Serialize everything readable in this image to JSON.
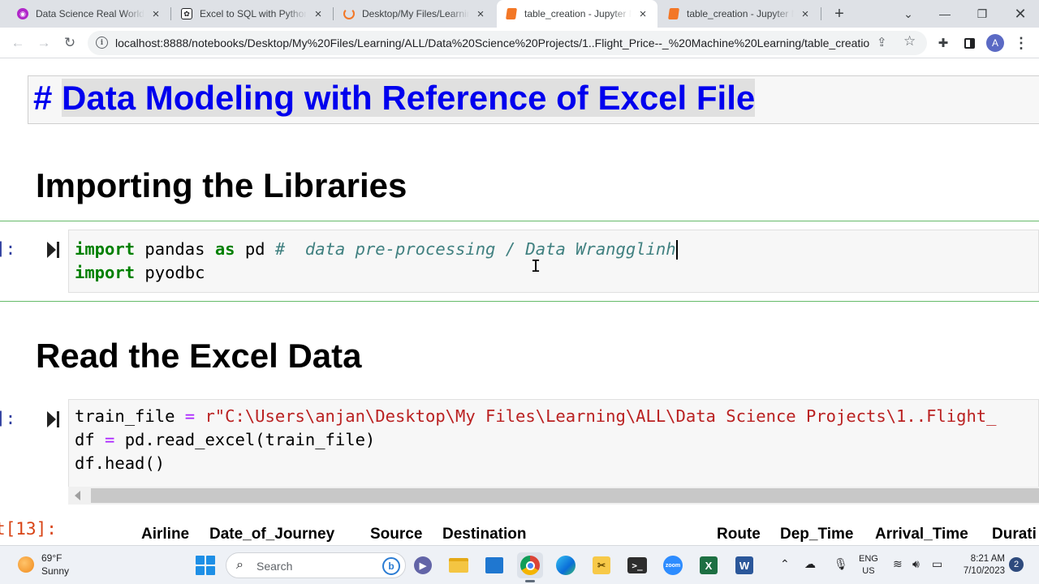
{
  "browser": {
    "tabs": [
      {
        "label": "Data Science Real World P",
        "icon": "youtube-icon",
        "color": "#c4302b"
      },
      {
        "label": "Excel to SQL with Python",
        "icon": "chatgpt-icon",
        "color": "#19a37e"
      },
      {
        "label": "Desktop/My Files/Learning",
        "icon": "jupyter-icon",
        "color": "#f37726"
      },
      {
        "label": "table_creation - Jupyter N",
        "icon": "notebook-icon",
        "color": "#f37726"
      },
      {
        "label": "table_creation - Jupyter N",
        "icon": "notebook-icon",
        "color": "#f37726"
      }
    ],
    "active_tab": 3,
    "new_tab_label": "+",
    "url": "localhost:8888/notebooks/Desktop/My%20Files/Learning/ALL/Data%20Science%20Projects/1..Flight_Price--_%20Machine%20Learning/table_creatio...",
    "profile_initial": "A"
  },
  "notebook": {
    "title_hash": "#",
    "title_text": "Data Modeling with Reference of Excel File",
    "heading_libraries": "Importing the Libraries",
    "heading_read": "Read the Excel Data",
    "cell1": {
      "prompt": "]:",
      "line1_kw1": "import",
      "line1_mod": " pandas ",
      "line1_kw2": "as",
      "line1_alias": " pd ",
      "line1_comment": "#  data pre-processing / Data Wrangglinh",
      "line2_kw": "import",
      "line2_mod": " pyodbc"
    },
    "cell2": {
      "prompt": "]:",
      "line1_var": "train_file ",
      "line1_eq": "=",
      "line1_str": " r\"C:\\Users\\anjan\\Desktop\\My Files\\Learning\\ALL\\Data Science Projects\\1..Flight_",
      "line2_a": "df ",
      "line2_eq": "=",
      "line2_b": " pd.read_excel(train_file)",
      "line3": "df.head()"
    },
    "output_prompt": "t[13]:",
    "df_columns": [
      "Airline",
      "Date_of_Journey",
      "Source",
      "Destination",
      "Route",
      "Dep_Time",
      "Arrival_Time",
      "Durati"
    ]
  },
  "taskbar": {
    "weather_temp": "69°F",
    "weather_desc": "Sunny",
    "search_placeholder": "Search",
    "lang_line1": "ENG",
    "lang_line2": "US",
    "time": "8:21 AM",
    "date": "7/10/2023",
    "notification_count": "2"
  }
}
